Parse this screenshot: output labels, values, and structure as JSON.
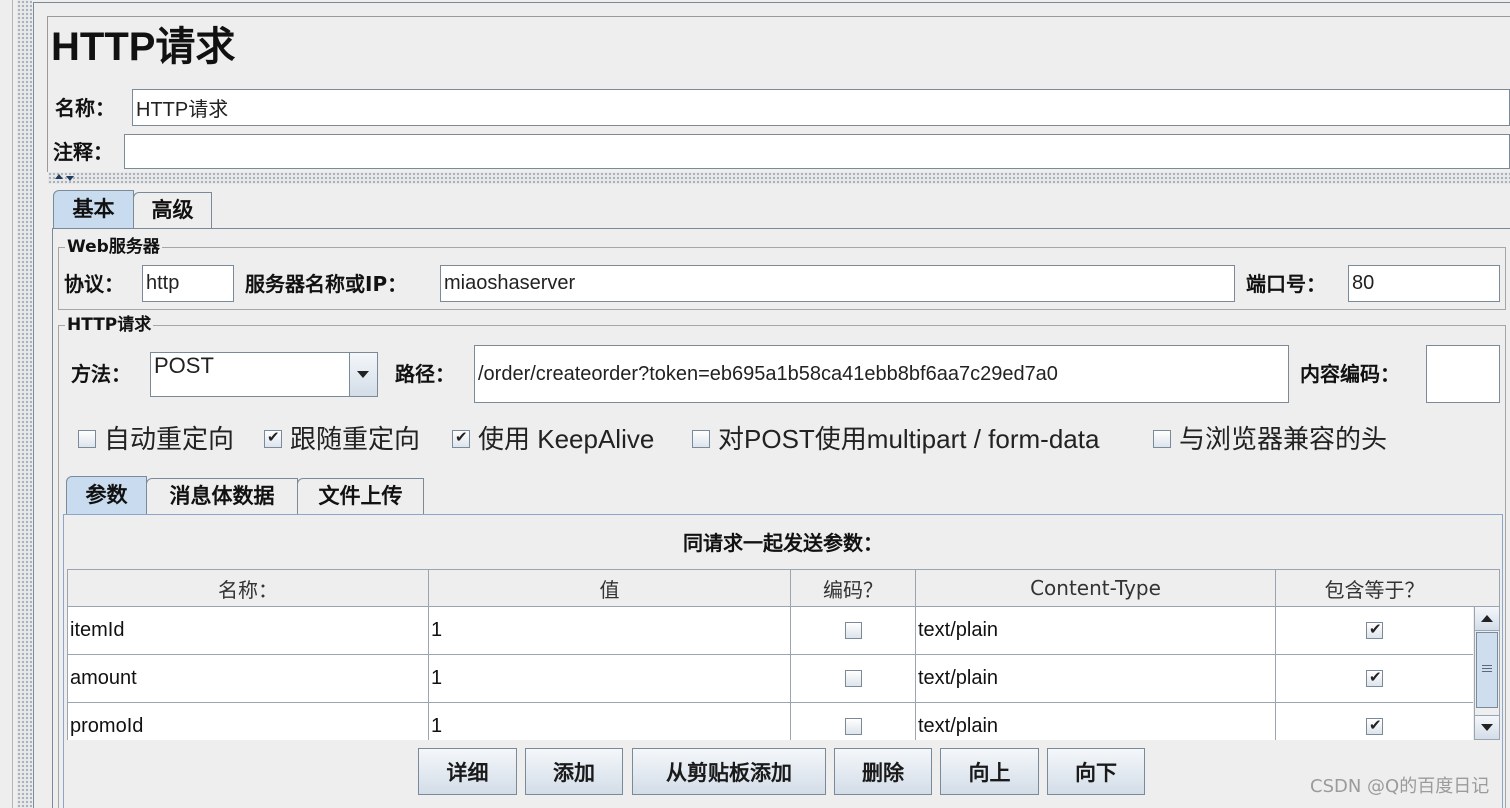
{
  "panel": {
    "title": "HTTP请求",
    "name_label": "名称：",
    "name_value": "HTTP请求",
    "comment_label": "注释："
  },
  "tabs": [
    {
      "label": "基本",
      "selected": true
    },
    {
      "label": "高级",
      "selected": false
    }
  ],
  "web_server": {
    "title": "Web服务器",
    "protocol_label": "协议：",
    "protocol_value": "http",
    "server_label": "服务器名称或IP：",
    "server_value": "miaoshaserver",
    "port_label": "端口号：",
    "port_value": "80"
  },
  "http_request": {
    "title": "HTTP请求",
    "method_label": "方法：",
    "method_value": "POST",
    "path_label": "路径：",
    "path_value": "/order/createorder?token=eb695a1b58ca41ebb8bf6aa7c29ed7a0",
    "encoding_label": "内容编码："
  },
  "options": [
    {
      "label": "自动重定向",
      "checked": false
    },
    {
      "label": "跟随重定向",
      "checked": true
    },
    {
      "label": "使用 KeepAlive",
      "checked": true
    },
    {
      "label": "对POST使用multipart / form-data",
      "checked": false
    },
    {
      "label": "与浏览器兼容的头",
      "checked": false
    }
  ],
  "body_tabs": [
    {
      "label": "参数",
      "selected": true
    },
    {
      "label": "消息体数据",
      "selected": false
    },
    {
      "label": "文件上传",
      "selected": false
    }
  ],
  "parameters": {
    "heading": "同请求一起发送参数：",
    "columns": [
      "名称：",
      "值",
      "编码？",
      "Content-Type",
      "包含等于？"
    ],
    "rows": [
      {
        "name": "itemId",
        "value": "1",
        "encode": false,
        "content_type": "text/plain",
        "include_equals": true
      },
      {
        "name": "amount",
        "value": "1",
        "encode": false,
        "content_type": "text/plain",
        "include_equals": true
      },
      {
        "name": "promoId",
        "value": "1",
        "encode": false,
        "content_type": "text/plain",
        "include_equals": true
      }
    ]
  },
  "buttons": [
    "详细",
    "添加",
    "从剪贴板添加",
    "删除",
    "向上",
    "向下"
  ],
  "watermark": "CSDN @Q的百度日记"
}
